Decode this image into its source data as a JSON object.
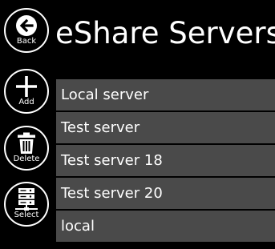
{
  "header": {
    "title": "eShare Servers"
  },
  "app_bar": {
    "buttons": [
      {
        "label": "Back",
        "icon": "arrow-left-icon"
      },
      {
        "label": "Add",
        "icon": "plus-icon"
      },
      {
        "label": "Delete",
        "icon": "trash-icon"
      },
      {
        "label": "Select",
        "icon": "server-icon"
      }
    ]
  },
  "servers": [
    {
      "name": "Local server"
    },
    {
      "name": "Test server"
    },
    {
      "name": "Test server 18"
    },
    {
      "name": "Test server 20"
    },
    {
      "name": "local"
    }
  ],
  "colors": {
    "background": "#000000",
    "foreground": "#ffffff",
    "list_item_background": "#4a4a4a"
  }
}
